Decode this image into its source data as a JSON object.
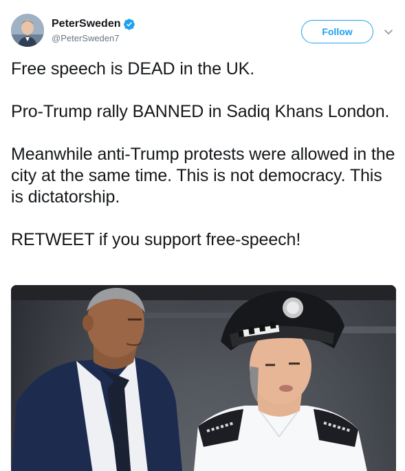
{
  "user": {
    "display_name": "PeterSweden",
    "handle": "@PeterSweden7",
    "verified": true,
    "avatar_icon": "user-avatar"
  },
  "follow_button": {
    "label": "Follow"
  },
  "menu": {
    "icon": "chevron-down-icon"
  },
  "tweet": {
    "paragraphs": [
      "Free speech is DEAD in the UK.",
      "Pro-Trump rally BANNED in Sadiq Khans London.",
      "Meanwhile anti-Trump protests were allowed in the city at the same time. This is not democracy. This is dictatorship.",
      "RETWEET if you support free-speech!"
    ]
  },
  "media": {
    "kind": "photo",
    "description_icon": "photo-two-people"
  },
  "colors": {
    "accent": "#1da1f2",
    "text": "#14171a",
    "secondary_text": "#657786"
  }
}
